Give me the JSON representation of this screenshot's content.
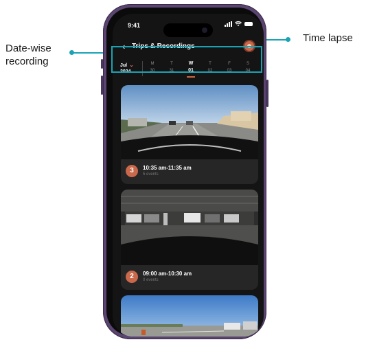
{
  "callouts": {
    "left_label_line1": "Date-wise",
    "left_label_line2": "recording",
    "right_label": "Time lapse",
    "accent_color": "#1aa3b5"
  },
  "status_bar": {
    "time": "9:41"
  },
  "header": {
    "back_icon": "chevron-left-icon",
    "title": "Trips & Recordings",
    "timelapse_icon": "time-lapse-icon"
  },
  "date_bar": {
    "month": "Jul",
    "year": "2024",
    "days": [
      {
        "name": "M",
        "date": "30",
        "active": false
      },
      {
        "name": "T",
        "date": "31",
        "active": false
      },
      {
        "name": "W",
        "date": "01",
        "active": true
      },
      {
        "name": "T",
        "date": "02",
        "active": false
      },
      {
        "name": "F",
        "date": "03",
        "active": false
      },
      {
        "name": "S",
        "date": "04",
        "active": false
      }
    ]
  },
  "trips": [
    {
      "number": "3",
      "time_range": "10:35 am-11:35 am",
      "events": "5 events",
      "scene": "highway"
    },
    {
      "number": "2",
      "time_range": "09:00 am-10:30 am",
      "events": "0 events",
      "scene": "parking-garage"
    },
    {
      "number": "",
      "time_range": "",
      "events": "",
      "scene": "highway-sky"
    }
  ],
  "colors": {
    "accent": "#c9684a",
    "background": "#141414",
    "card": "#262626"
  }
}
